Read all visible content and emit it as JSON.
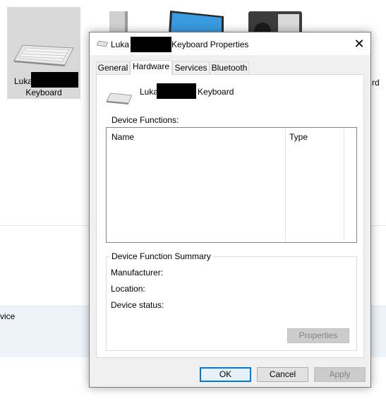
{
  "background": {
    "selected_device": {
      "name_prefix": "Luka",
      "name_suffix": "Keyboard"
    },
    "partial_right_label": "rd",
    "detail_partial_text": "vice"
  },
  "dialog": {
    "title_prefix": "Luka",
    "title_suffix": "Keyboard Properties",
    "close_glyph": "✕",
    "tabs": [
      {
        "label": "General",
        "active": false
      },
      {
        "label": "Hardware",
        "active": true
      },
      {
        "label": "Services",
        "active": false
      },
      {
        "label": "Bluetooth",
        "active": false
      }
    ],
    "device": {
      "name_prefix": "Luka",
      "name_suffix": "Keyboard"
    },
    "device_functions_label": "Device Functions:",
    "columns": {
      "name": "Name",
      "type": "Type"
    },
    "summary": {
      "title": "Device Function Summary",
      "manufacturer_label": "Manufacturer:",
      "location_label": "Location:",
      "status_label": "Device status:",
      "properties_button": "Properties"
    },
    "buttons": {
      "ok": "OK",
      "cancel": "Cancel",
      "apply": "Apply"
    }
  }
}
